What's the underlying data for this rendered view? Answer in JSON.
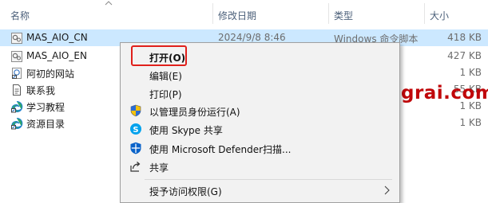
{
  "columns": {
    "name": "名称",
    "date": "修改日期",
    "type": "类型",
    "size": "大小"
  },
  "files": [
    {
      "name": "MAS_AIO_CN",
      "date": "2024/9/8 8:46",
      "type": "Windows 命令脚本",
      "size": "418 KB",
      "icon": "script-file-icon",
      "selected": true
    },
    {
      "name": "MAS_AIO_EN",
      "date": "",
      "type": "脚本",
      "size": "427 KB",
      "icon": "script-file-icon"
    },
    {
      "name": "阿初的网站",
      "date": "",
      "type": "式",
      "size": "1 KB",
      "icon": "web-shortcut-icon"
    },
    {
      "name": "联系我",
      "date": "",
      "type": "",
      "size": "55 KB",
      "icon": "document-icon"
    },
    {
      "name": "学习教程",
      "date": "",
      "type": "式",
      "size": "1 KB",
      "icon": "edge-shortcut-icon"
    },
    {
      "name": "资源目录",
      "date": "",
      "type": "式",
      "size": "1 KB",
      "icon": "edge-shortcut-icon"
    }
  ],
  "context_menu": {
    "items": [
      {
        "label": "打开(O)",
        "icon": "",
        "bold": true
      },
      {
        "label": "编辑(E)",
        "icon": ""
      },
      {
        "label": "打印(P)",
        "icon": ""
      },
      {
        "label": "以管理员身份运行(A)",
        "icon": "uac-shield-icon"
      },
      {
        "label": "使用 Skype 共享",
        "icon": "skype-icon"
      },
      {
        "label": "使用 Microsoft Defender扫描...",
        "icon": "defender-shield-icon"
      },
      {
        "label": "共享",
        "icon": "share-icon"
      },
      {
        "label": "授予访问权限(G)",
        "icon": "",
        "submenu": true
      }
    ]
  },
  "watermark": "www.dgrai.com",
  "colors": {
    "selection": "#cce8ff",
    "highlight_border": "#e0201b",
    "watermark": "#c0070a"
  }
}
